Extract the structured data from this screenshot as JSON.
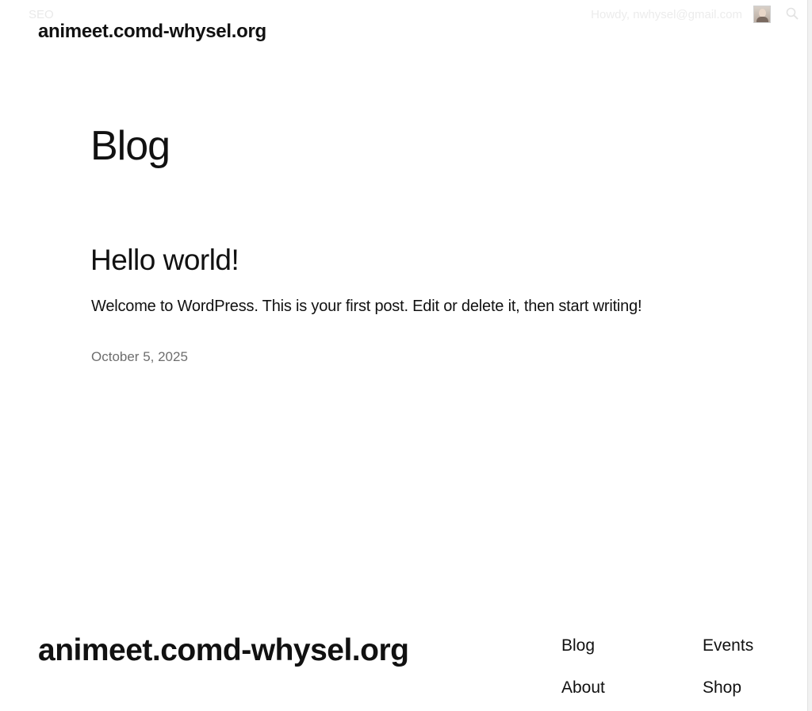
{
  "adminbar": {
    "seo_label": "SEO",
    "howdy_text": "Howdy, nwhysel@gmail.com",
    "avatar_icon": "user-avatar-photo",
    "search_icon": "search-icon"
  },
  "header": {
    "site_title": "animeet.comd-whysel.org"
  },
  "main": {
    "page_title": "Blog",
    "posts": [
      {
        "title": "Hello world!",
        "excerpt": "Welcome to WordPress. This is your first post. Edit or delete it, then start writing!",
        "date": "October 5, 2025"
      }
    ]
  },
  "footer": {
    "site_title": "animeet.comd-whysel.org",
    "nav": [
      "Blog",
      "Events",
      "About",
      "Shop"
    ]
  },
  "colors": {
    "text": "#111111",
    "date": "#6e6e6e",
    "background": "#ffffff"
  }
}
